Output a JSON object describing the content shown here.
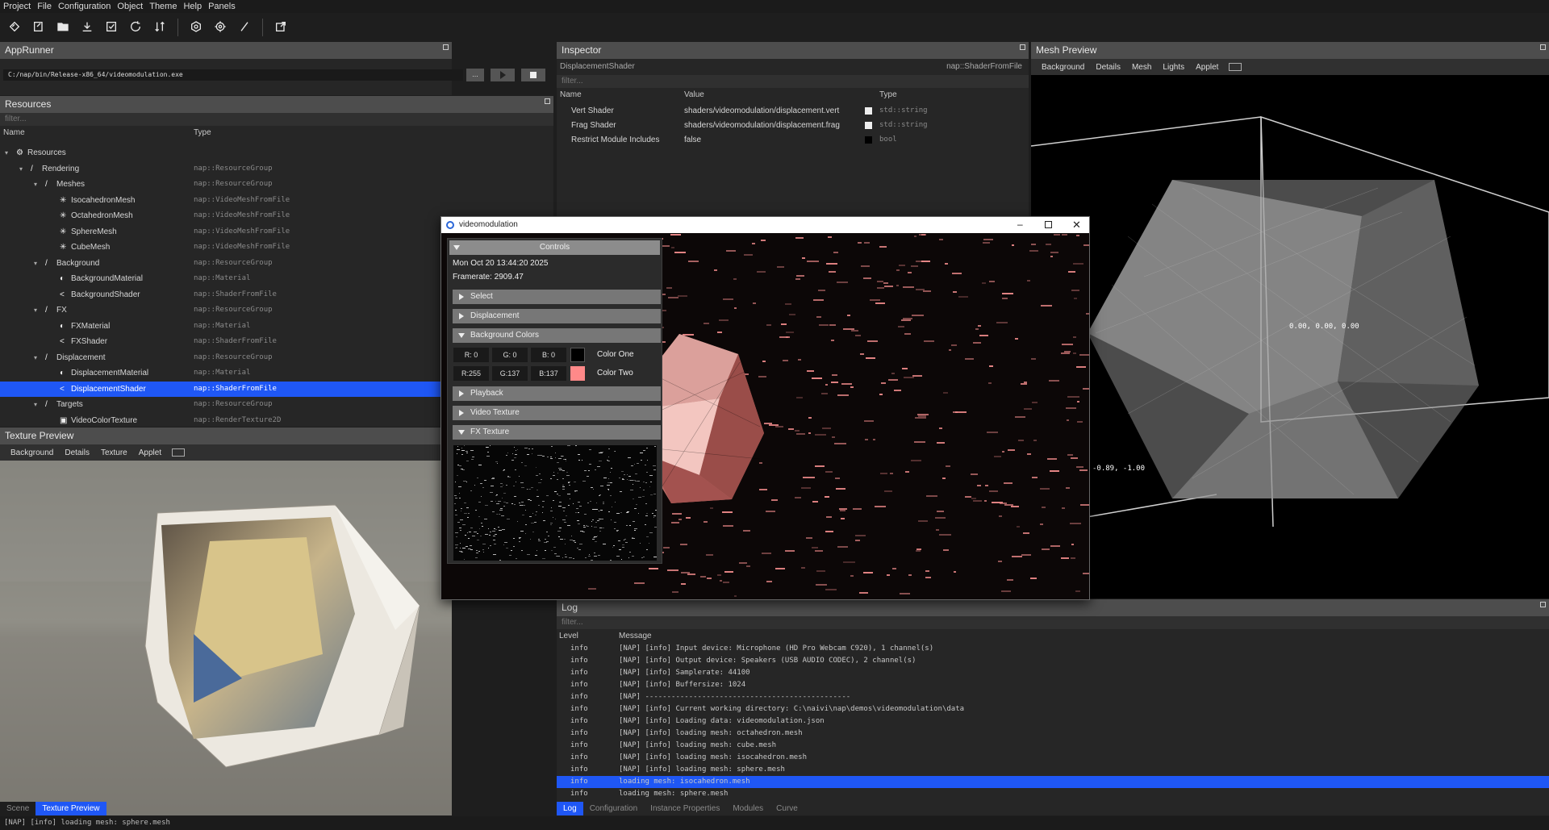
{
  "menu": [
    "Project",
    "File",
    "Configuration",
    "Object",
    "Theme",
    "Help",
    "Panels"
  ],
  "toolbar": [
    "logo-icon",
    "new-file-icon",
    "open-folder-icon",
    "download-icon",
    "checklist-icon",
    "reload-icon",
    "sort-icon",
    "settings-icon",
    "service-config-icon",
    "slash-icon",
    "external-open-icon"
  ],
  "apprunner": {
    "title": "AppRunner",
    "path": "C:/nap/bin/Release-x86_64/videomodulation.exe",
    "browse": "..."
  },
  "resources": {
    "title": "Resources",
    "filter": "filter...",
    "col_name": "Name",
    "col_type": "Type",
    "rows": [
      {
        "label": "Resources",
        "type": "",
        "icon": "gear",
        "depth": 0,
        "arrow": true
      },
      {
        "label": "Rendering",
        "type": "nap::ResourceGroup",
        "icon": "slash",
        "depth": 1,
        "arrow": true
      },
      {
        "label": "Meshes",
        "type": "nap::ResourceGroup",
        "icon": "slash",
        "depth": 2,
        "arrow": true
      },
      {
        "label": "IsocahedronMesh",
        "type": "nap::VideoMeshFromFile",
        "icon": "star",
        "depth": 3
      },
      {
        "label": "OctahedronMesh",
        "type": "nap::VideoMeshFromFile",
        "icon": "star",
        "depth": 3
      },
      {
        "label": "SphereMesh",
        "type": "nap::VideoMeshFromFile",
        "icon": "star",
        "depth": 3
      },
      {
        "label": "CubeMesh",
        "type": "nap::VideoMeshFromFile",
        "icon": "star",
        "depth": 3
      },
      {
        "label": "Background",
        "type": "nap::ResourceGroup",
        "icon": "slash",
        "depth": 2,
        "arrow": true
      },
      {
        "label": "BackgroundMaterial",
        "type": "nap::Material",
        "icon": "material",
        "depth": 3
      },
      {
        "label": "BackgroundShader",
        "type": "nap::ShaderFromFile",
        "icon": "shader",
        "depth": 3
      },
      {
        "label": "FX",
        "type": "nap::ResourceGroup",
        "icon": "slash",
        "depth": 2,
        "arrow": true
      },
      {
        "label": "FXMaterial",
        "type": "nap::Material",
        "icon": "material",
        "depth": 3
      },
      {
        "label": "FXShader",
        "type": "nap::ShaderFromFile",
        "icon": "shader",
        "depth": 3
      },
      {
        "label": "Displacement",
        "type": "nap::ResourceGroup",
        "icon": "slash",
        "depth": 2,
        "arrow": true
      },
      {
        "label": "DisplacementMaterial",
        "type": "nap::Material",
        "icon": "material",
        "depth": 3
      },
      {
        "label": "DisplacementShader",
        "type": "nap::ShaderFromFile",
        "icon": "shader",
        "depth": 3,
        "selected": true
      },
      {
        "label": "Targets",
        "type": "nap::ResourceGroup",
        "icon": "slash",
        "depth": 2,
        "arrow": true
      },
      {
        "label": "VideoColorTexture",
        "type": "nap::RenderTexture2D",
        "icon": "image",
        "depth": 3
      }
    ]
  },
  "texture_preview": {
    "title": "Texture Preview",
    "tabs": [
      "Background",
      "Details",
      "Texture",
      "Applet"
    ]
  },
  "inspector": {
    "title": "Inspector",
    "object": "DisplacementShader",
    "object_type": "nap::ShaderFromFile",
    "filter": "filter...",
    "col_name": "Name",
    "col_value": "Value",
    "col_type": "Type",
    "rows": [
      {
        "name": "Vert Shader",
        "value": "shaders/videomodulation/displacement.vert",
        "type": "std::string"
      },
      {
        "name": "Frag Shader",
        "value": "shaders/videomodulation/displacement.frag",
        "type": "std::string"
      },
      {
        "name": "Restrict Module Includes",
        "value": "false",
        "type": "bool"
      }
    ]
  },
  "mesh_preview": {
    "title": "Mesh Preview",
    "tabs": [
      "Background",
      "Details",
      "Mesh",
      "Lights",
      "Applet"
    ],
    "center_label": "0.00, 0.00, 0.00",
    "corner_label": "-0.89, -1.00"
  },
  "app_window": {
    "title": "videomodulation",
    "controls": {
      "title": "Controls",
      "datetime": "Mon Oct 20 13:44:20 2025",
      "framerate": "Framerate: 2909.47",
      "sections": [
        "Select",
        "Displacement",
        "Background Colors",
        "Playback",
        "Video Texture",
        "FX Texture"
      ],
      "color_one": {
        "r": "R: 0",
        "g": "G: 0",
        "b": "B: 0",
        "label": "Color One",
        "swatch": "#000000"
      },
      "color_two": {
        "r": "R:255",
        "g": "G:137",
        "b": "B:137",
        "label": "Color Two",
        "swatch": "#ff8989"
      }
    }
  },
  "log": {
    "title": "Log",
    "filter": "filter...",
    "col_level": "Level",
    "col_message": "Message",
    "rows": [
      {
        "level": "info",
        "message": "[NAP] [info] Input device: Microphone (HD Pro Webcam C920), 1 channel(s)"
      },
      {
        "level": "info",
        "message": "[NAP] [info] Output device: Speakers (USB AUDIO  CODEC), 2 channel(s)"
      },
      {
        "level": "info",
        "message": "[NAP] [info] Samplerate: 44100"
      },
      {
        "level": "info",
        "message": "[NAP] [info] Buffersize: 1024"
      },
      {
        "level": "info",
        "message": "[NAP] -----------------------------------------------"
      },
      {
        "level": "info",
        "message": "[NAP] [info] Current working directory: C:\\naivi\\nap\\demos\\videomodulation\\data"
      },
      {
        "level": "info",
        "message": "[NAP] [info] Loading data: videomodulation.json"
      },
      {
        "level": "info",
        "message": "[NAP] [info] loading mesh: octahedron.mesh"
      },
      {
        "level": "info",
        "message": "[NAP] [info] loading mesh: cube.mesh"
      },
      {
        "level": "info",
        "message": "[NAP] [info] loading mesh: isocahedron.mesh"
      },
      {
        "level": "info",
        "message": "[NAP] [info] loading mesh: sphere.mesh"
      },
      {
        "level": "info",
        "message": "loading mesh: isocahedron.mesh",
        "selected": true
      },
      {
        "level": "info",
        "message": "loading mesh: sphere.mesh"
      }
    ],
    "tabs": [
      "Log",
      "Configuration",
      "Instance Properties",
      "Modules",
      "Curve"
    ]
  },
  "left_tabs": [
    "Scene",
    "Texture Preview"
  ],
  "status": "[NAP] [info] loading mesh: sphere.mesh",
  "colors": {
    "accent": "#1f57f5",
    "panel_title": "#4d4d4d",
    "pink": "#f28c8c"
  }
}
